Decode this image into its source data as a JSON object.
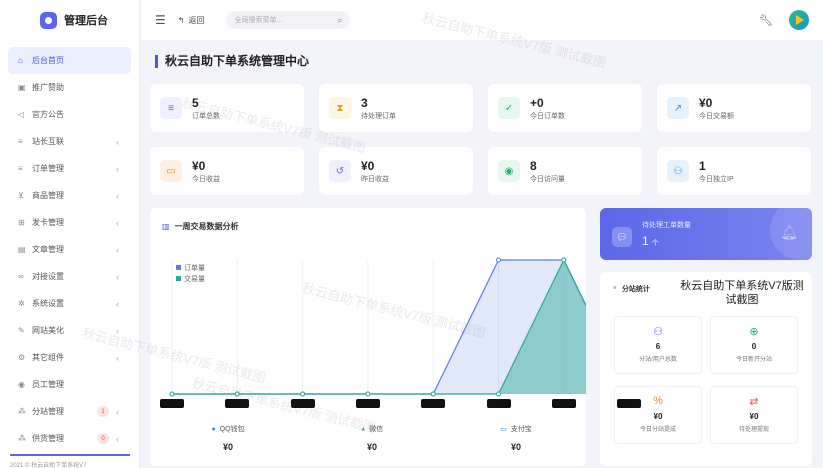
{
  "app": {
    "title": "管理后台"
  },
  "sidebar": {
    "items": [
      {
        "label": "后台首页",
        "icon": "home-icon",
        "active": true
      },
      {
        "label": "推广赞助",
        "icon": "image-icon"
      },
      {
        "label": "官方公告",
        "icon": "megaphone-icon"
      },
      {
        "label": "站长互联",
        "icon": "list-icon",
        "chev": true
      },
      {
        "label": "订单管理",
        "icon": "list-icon",
        "chev": true
      },
      {
        "label": "商品管理",
        "icon": "cart-icon",
        "chev": true
      },
      {
        "label": "发卡管理",
        "icon": "grid-icon",
        "chev": true
      },
      {
        "label": "文章管理",
        "icon": "document-icon",
        "chev": true
      },
      {
        "label": "对接设置",
        "icon": "link-icon",
        "chev": true
      },
      {
        "label": "系统设置",
        "icon": "gear-icon",
        "chev": true
      },
      {
        "label": "网站美化",
        "icon": "brush-icon",
        "chev": true
      },
      {
        "label": "其它组件",
        "icon": "cogs-icon",
        "chev": true
      },
      {
        "label": "员工管理",
        "icon": "user-icon"
      },
      {
        "label": "分站管理",
        "icon": "sitemap-icon",
        "badge": "1",
        "chev": true
      },
      {
        "label": "供货管理",
        "icon": "sitemap-icon",
        "badge": "0",
        "chev": true
      }
    ],
    "footer": "2021 © 秋云自助下单系统V7"
  },
  "topbar": {
    "back": "返回",
    "search_placeholder": "全局搜索菜单..."
  },
  "page": {
    "title": "秋云自助下单系统管理中心"
  },
  "stats": [
    {
      "value": "5",
      "label": "订单总数",
      "icon": "list-icon",
      "color": "#5b67e8",
      "bg": "#eef0fd"
    },
    {
      "value": "3",
      "label": "待处理订单",
      "icon": "hourglass-icon",
      "color": "#e0a020",
      "bg": "#fdf5e3"
    },
    {
      "value": "+0",
      "label": "今日订单数",
      "icon": "calendar-check-icon",
      "color": "#27ae73",
      "bg": "#e5f7ee"
    },
    {
      "value": "¥0",
      "label": "今日交易额",
      "icon": "chart-line-icon",
      "color": "#2a8fd6",
      "bg": "#e5f1fb"
    },
    {
      "value": "¥0",
      "label": "今日收益",
      "icon": "money-icon",
      "color": "#e88a2a",
      "bg": "#fdf0e3"
    },
    {
      "value": "¥0",
      "label": "昨日收益",
      "icon": "history-icon",
      "color": "#5b67e8",
      "bg": "#eef0fd"
    },
    {
      "value": "8",
      "label": "今日访问量",
      "icon": "eye-icon",
      "color": "#27ae73",
      "bg": "#e5f7ee"
    },
    {
      "value": "1",
      "label": "今日独立IP",
      "icon": "users-icon",
      "color": "#2a8fd6",
      "bg": "#e5f1fb"
    }
  ],
  "chart_data": {
    "type": "area",
    "title": "一周交易数据分析",
    "series": [
      {
        "name": "订单量",
        "color": "#5b7fd6",
        "values": [
          0,
          0,
          0,
          0,
          0,
          2,
          2,
          0
        ]
      },
      {
        "name": "交易量",
        "color": "#2aa89a",
        "values": [
          0,
          0,
          0,
          0,
          0,
          0,
          2,
          0
        ]
      }
    ],
    "ylim": [
      0,
      2
    ],
    "grid": true,
    "legend": "top-left"
  },
  "payments": [
    {
      "label": "QQ钱包",
      "value": "¥0",
      "icon": "qq-icon",
      "color": "#2a8fd6"
    },
    {
      "label": "微信",
      "value": "¥0",
      "icon": "wechat-icon",
      "color": "#27ae73"
    },
    {
      "label": "支付宝",
      "value": "¥0",
      "icon": "alipay-icon",
      "color": "#2a8fd6"
    }
  ],
  "workorder": {
    "title": "待处理工单数量",
    "value": "1",
    "unit": "个"
  },
  "branch": {
    "title": "分站统计",
    "watermark": "秋云自助下单系统V7版测试截图",
    "cells": [
      {
        "value": "6",
        "label": "分站/用户总数",
        "icon": "users-icon",
        "color": "#5b67e8"
      },
      {
        "value": "0",
        "label": "今日新开分站",
        "icon": "plus-circle-icon",
        "color": "#27ae73"
      },
      {
        "value": "¥0",
        "label": "今日分站提成",
        "icon": "percent-icon",
        "color": "#e88a2a"
      },
      {
        "value": "¥0",
        "label": "待处理提现",
        "icon": "exchange-icon",
        "color": "#e05252"
      }
    ]
  },
  "watermarks": [
    "秋云自助下单系统V7版 测试截图",
    "秋云自助下单系统V7版 测试截图",
    "秋云自助下单系统V7版 测试截图",
    "秋云自助下单系统V7版 测试截图",
    "秋云自助下单系统V7版 测试截图"
  ]
}
